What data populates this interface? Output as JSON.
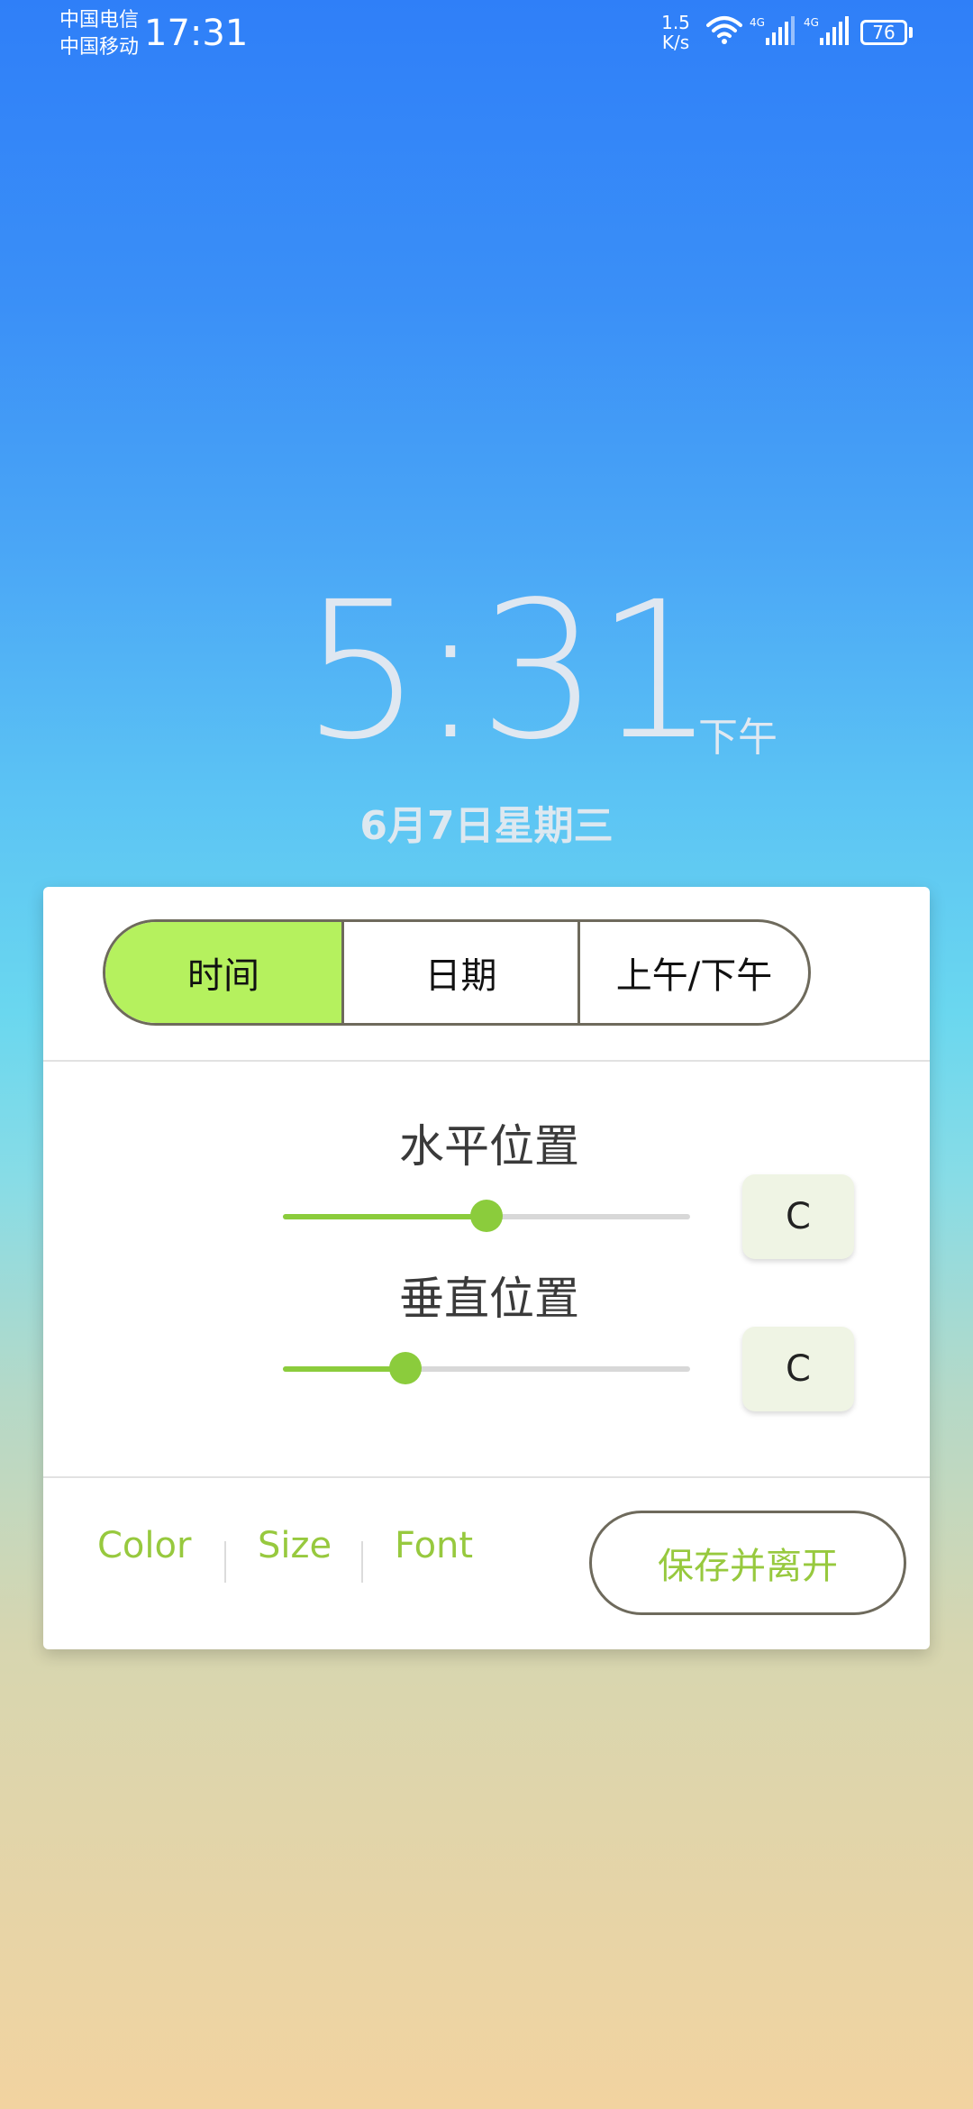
{
  "status_bar": {
    "carrier_1": "中国电信",
    "carrier_2": "中国移动",
    "time": "17:31",
    "net_speed_value": "1.5",
    "net_speed_unit": "K/s",
    "signal_1_label": "4G",
    "signal_2_label": "4G",
    "battery": "76"
  },
  "lock_clock": {
    "time": "5:31",
    "ampm": "下午",
    "date": "6月7日星期三"
  },
  "panel": {
    "tabs": [
      {
        "label": "时间",
        "active": true
      },
      {
        "label": "日期",
        "active": false
      },
      {
        "label": "上午/下午",
        "active": false
      }
    ],
    "horizontal": {
      "title": "水平位置",
      "value": 0.5,
      "reset_label": "C"
    },
    "vertical": {
      "title": "垂直位置",
      "value": 0.3,
      "reset_label": "C"
    },
    "toolbar": {
      "color_label": "Color",
      "size_label": "Size",
      "font_label": "Font",
      "save_label": "保存并离开"
    }
  },
  "colors": {
    "accent": "#8bcc3c",
    "active_tab": "#b5f15e",
    "link": "#97c93e"
  }
}
